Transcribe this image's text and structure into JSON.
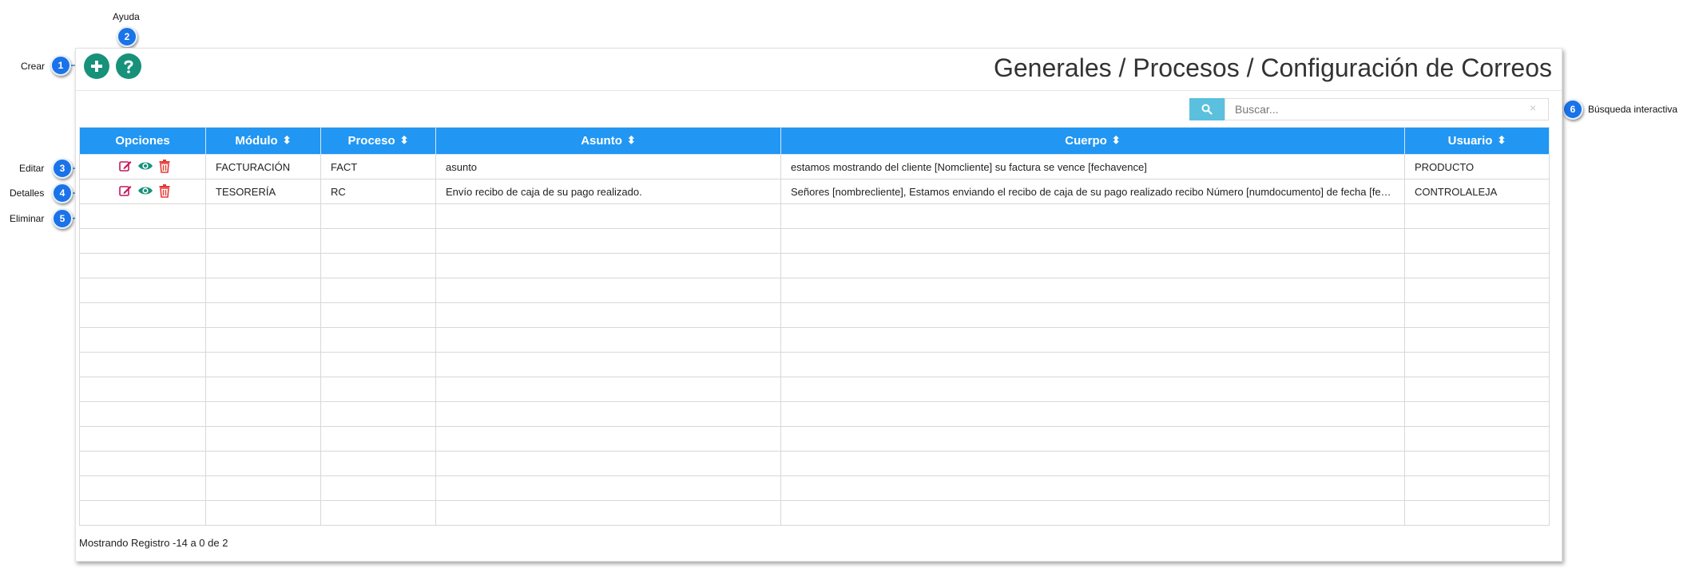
{
  "page": {
    "title": "Generales / Procesos / Configuración de Correos"
  },
  "toolbar": {
    "create_icon": "plus-icon",
    "help_icon": "question-icon"
  },
  "search": {
    "placeholder": "Buscar...",
    "clear_glyph": "×",
    "icon": "search-icon"
  },
  "table": {
    "columns": [
      {
        "label": "Opciones",
        "sortable": false
      },
      {
        "label": "Módulo",
        "sortable": true
      },
      {
        "label": "Proceso",
        "sortable": true
      },
      {
        "label": "Asunto",
        "sortable": true
      },
      {
        "label": "Cuerpo",
        "sortable": true
      },
      {
        "label": "Usuario",
        "sortable": true
      }
    ],
    "rows": [
      {
        "modulo": "FACTURACIÓN",
        "proceso": "FACT",
        "asunto": "asunto",
        "cuerpo": "estamos mostrando del cliente [Nomcliente] su factura se vence [fechavence]",
        "usuario": "PRODUCTO"
      },
      {
        "modulo": "TESORERÍA",
        "proceso": "RC",
        "asunto": "Envío recibo de caja de su pago realizado.",
        "cuerpo": "Señores [nombrecliente], Estamos enviando el recibo de caja de su pago realizado recibo Número [numdocumento] de fecha [fechad...",
        "usuario": "CONTROLALEJA"
      }
    ],
    "row_action_icons": [
      "edit-icon",
      "eye-icon",
      "trash-icon"
    ]
  },
  "footer": {
    "text": "Mostrando Registro -14 a 0 de 2"
  },
  "annotations": [
    {
      "number": "1",
      "label": "Crear"
    },
    {
      "number": "2",
      "label": "Ayuda"
    },
    {
      "number": "3",
      "label": "Editar"
    },
    {
      "number": "4",
      "label": "Detalles"
    },
    {
      "number": "5",
      "label": "Eliminar"
    },
    {
      "number": "6",
      "label": "Búsqueda interactiva"
    }
  ],
  "colors": {
    "header_bg": "#2196f3",
    "action_green": "#17917a",
    "search_button": "#5bc0de",
    "callout_blue": "#1a73e8",
    "edit_icon": "#c2185b",
    "view_icon": "#17917a",
    "delete_icon": "#e53935"
  }
}
